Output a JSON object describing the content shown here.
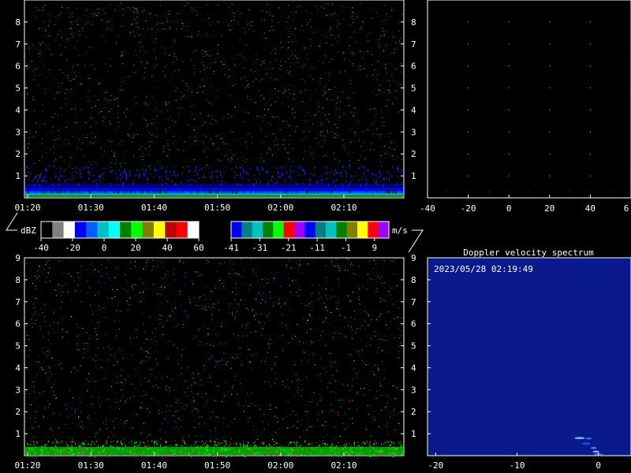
{
  "chart_data": [
    {
      "type": "heatmap",
      "name": "reflectivity-time-height",
      "xlabel": "",
      "ylabel": "",
      "x_ticks": [
        "01:20",
        "01:30",
        "01:40",
        "01:50",
        "02:00",
        "02:10"
      ],
      "y_ticks": [
        "1",
        "2",
        "3",
        "4",
        "5",
        "6",
        "7",
        "8"
      ],
      "ylim": [
        0,
        9
      ],
      "colorbar": {
        "unit": "dBZ",
        "ticks": [
          "-40",
          "-20",
          "0",
          "20",
          "40",
          "60"
        ],
        "range": [
          -40,
          60
        ],
        "colors": [
          "#000000",
          "#808080",
          "#ffffff",
          "#0000ff",
          "#0060ff",
          "#00c0c0",
          "#00ffff",
          "#008000",
          "#00ff00",
          "#808000",
          "#ffff00",
          "#c00000",
          "#ff0000",
          "#ffffff"
        ]
      },
      "notes": "Strong echo band below ~0.5 km; sparse noise above"
    },
    {
      "type": "scatter",
      "name": "upper-right-empty-panel",
      "x_ticks": [
        "-40",
        "-20",
        "0",
        "20",
        "40",
        "6"
      ],
      "y_ticks": [
        "1",
        "2",
        "3",
        "4",
        "5",
        "6",
        "7",
        "8"
      ],
      "xlim": [
        -40,
        60
      ],
      "ylim": [
        0,
        9
      ],
      "grid": "dotted"
    },
    {
      "type": "heatmap",
      "name": "doppler-velocity-time-height",
      "x_ticks": [
        "01:20",
        "01:30",
        "01:40",
        "01:50",
        "02:00",
        "02:10"
      ],
      "y_ticks": [
        "1",
        "2",
        "3",
        "4",
        "5",
        "6",
        "7",
        "8",
        "9"
      ],
      "ylim": [
        0,
        9
      ],
      "colorbar": {
        "unit": "m/s",
        "ticks": [
          "-41",
          "-31",
          "-21",
          "-11",
          "-1",
          "9"
        ],
        "range": [
          -41,
          14
        ],
        "colors": [
          "#0000ff",
          "#008080",
          "#00c0c0",
          "#008000",
          "#00ff00",
          "#ff0000",
          "#a000ff",
          "#0000ff",
          "#008080",
          "#00c0c0",
          "#008000",
          "#808000",
          "#ffff00",
          "#ff0000",
          "#a000ff"
        ]
      }
    },
    {
      "type": "heatmap",
      "name": "doppler-velocity-spectrum",
      "title": "Doppler velocity spectrum",
      "timestamp": "2023/05/28 02:19:49",
      "x_ticks": [
        "-20",
        "-10",
        "0"
      ],
      "y_ticks": [
        "1",
        "2",
        "3",
        "4",
        "5",
        "6",
        "7",
        "8",
        "9"
      ],
      "xlim": [
        -21,
        4
      ],
      "ylim": [
        0,
        9
      ]
    }
  ]
}
